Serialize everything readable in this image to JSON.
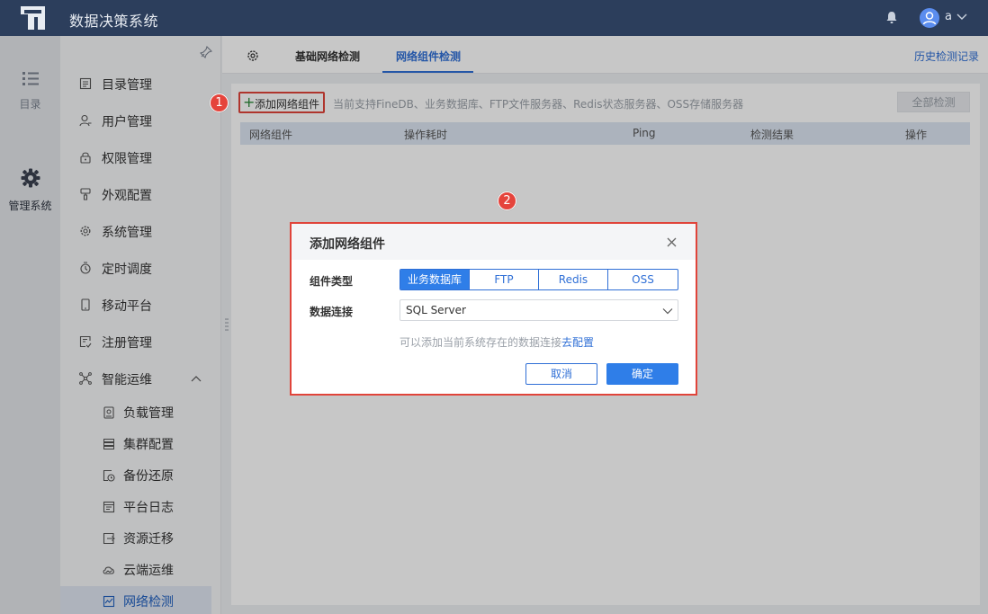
{
  "app": {
    "title": "数据决策系统",
    "user_name": "a"
  },
  "rail": [
    {
      "label": "目录",
      "icon": "list-icon"
    },
    {
      "label": "管理系统",
      "icon": "gear-icon"
    }
  ],
  "menu": {
    "items": [
      {
        "label": "目录管理",
        "icon": "directory-icon"
      },
      {
        "label": "用户管理",
        "icon": "user-icon"
      },
      {
        "label": "权限管理",
        "icon": "lock-icon"
      },
      {
        "label": "外观配置",
        "icon": "brush-icon"
      },
      {
        "label": "系统管理",
        "icon": "gear-icon"
      },
      {
        "label": "定时调度",
        "icon": "clock-icon"
      },
      {
        "label": "移动平台",
        "icon": "mobile-icon"
      },
      {
        "label": "注册管理",
        "icon": "register-icon"
      },
      {
        "label": "智能运维",
        "icon": "network-icon"
      }
    ],
    "sub_items": [
      {
        "label": "负载管理",
        "icon": "load-icon"
      },
      {
        "label": "集群配置",
        "icon": "cluster-icon"
      },
      {
        "label": "备份还原",
        "icon": "backup-icon"
      },
      {
        "label": "平台日志",
        "icon": "log-icon"
      },
      {
        "label": "资源迁移",
        "icon": "migrate-icon"
      },
      {
        "label": "云端运维",
        "icon": "cloud-icon"
      },
      {
        "label": "网络检测",
        "icon": "monitor-icon"
      }
    ]
  },
  "tabs": {
    "basic": "基础网络检测",
    "component": "网络组件检测",
    "history": "历史检测记录"
  },
  "toolbar": {
    "add_label": "添加网络组件",
    "support_text": "当前支持FineDB、业务数据库、FTP文件服务器、Redis状态服务器、OSS存储服务器",
    "check_all": "全部检测"
  },
  "table": {
    "headers": [
      "网络组件",
      "操作耗时",
      "Ping",
      "检测结果",
      "操作"
    ]
  },
  "markers": {
    "one": "1",
    "two": "2"
  },
  "dialog": {
    "title": "添加网络组件",
    "type_label": "组件类型",
    "types": [
      "业务数据库",
      "FTP",
      "Redis",
      "OSS"
    ],
    "selected_type": "业务数据库",
    "conn_label": "数据连接",
    "conn_value": "SQL Server",
    "hint": "可以添加当前系统存在的数据连接",
    "hint_link": "去配置",
    "cancel": "取消",
    "confirm": "确定"
  },
  "colors": {
    "header": "#2c3e5c",
    "accent": "#2f7ee8",
    "highlight": "#e0443a"
  }
}
